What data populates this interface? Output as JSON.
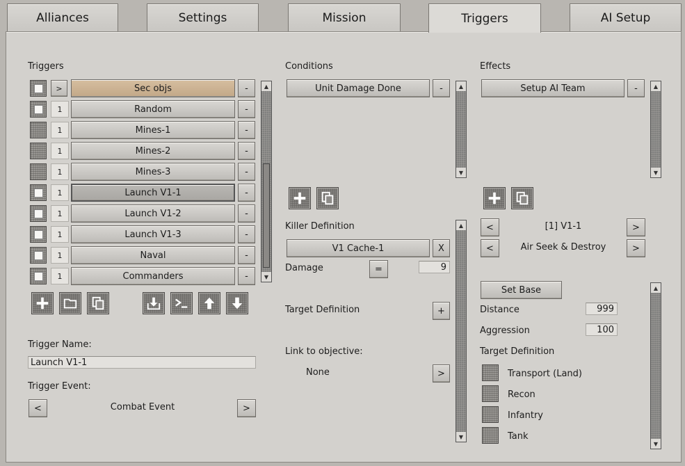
{
  "tabs": [
    "Alliances",
    "Settings",
    "Mission",
    "Triggers",
    "AI Setup"
  ],
  "triggers": {
    "heading": "Triggers",
    "items": [
      {
        "arrow": ">",
        "name": "Sec objs",
        "checked": true
      },
      {
        "num": "1",
        "name": "Random",
        "checked": true
      },
      {
        "num": "1",
        "name": "Mines-1",
        "checked": false
      },
      {
        "num": "1",
        "name": "Mines-2",
        "checked": false
      },
      {
        "num": "1",
        "name": "Mines-3",
        "checked": false
      },
      {
        "num": "1",
        "name": "Launch V1-1",
        "checked": true
      },
      {
        "num": "1",
        "name": "Launch V1-2",
        "checked": true
      },
      {
        "num": "1",
        "name": "Launch V1-3",
        "checked": true
      },
      {
        "num": "1",
        "name": "Naval",
        "checked": true
      },
      {
        "num": "1",
        "name": "Commanders",
        "checked": true
      }
    ],
    "remove_label": "-",
    "name_label": "Trigger Name:",
    "name_value": "Launch V1-1",
    "event_label": "Trigger Event:",
    "event_value": "Combat Event",
    "prev": "<",
    "next": ">"
  },
  "conditions": {
    "heading": "Conditions",
    "item": "Unit Damage Done",
    "remove": "-",
    "killer_label": "Killer Definition",
    "killer_value": "V1 Cache-1",
    "killer_clear": "X",
    "damage_label": "Damage",
    "damage_op": "=",
    "damage_value": "9",
    "target_label": "Target Definition",
    "target_add": "+",
    "link_label": "Link to objective:",
    "link_value": "None",
    "link_next": ">"
  },
  "effects": {
    "heading": "Effects",
    "item": "Setup AI Team",
    "remove": "-",
    "team": "[1] V1-1",
    "behavior": "Air Seek & Destroy",
    "prev": "<",
    "next": ">",
    "set_base": "Set Base",
    "distance_label": "Distance",
    "distance_value": "999",
    "aggression_label": "Aggression",
    "aggression_value": "100",
    "target_label": "Target Definition",
    "targets": [
      "Transport (Land)",
      "Recon",
      "Infantry",
      "Tank"
    ]
  }
}
